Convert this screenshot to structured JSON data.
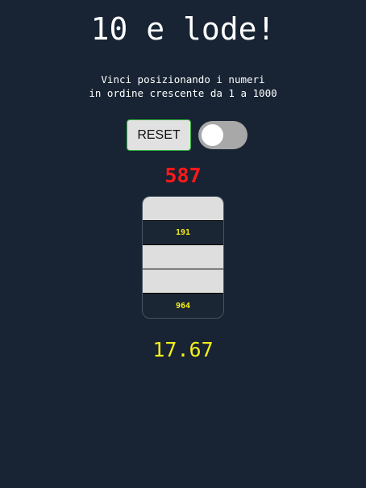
{
  "title": "10 e lode!",
  "subtitle": {
    "line1": "Vinci posizionando i numeri",
    "line2": "in ordine crescente da 1 a 1000"
  },
  "controls": {
    "reset_label": "RESET",
    "toggle_on": false
  },
  "current_number": "587",
  "slots": [
    {
      "value": ""
    },
    {
      "value": "191"
    },
    {
      "value": ""
    },
    {
      "value": ""
    },
    {
      "value": "964"
    }
  ],
  "score": "17.67",
  "colors": {
    "background": "#182433",
    "current_number": "#ff1a1a",
    "slot_text": "#f5ef1a",
    "score": "#f5ef1a",
    "empty_slot": "#dedede"
  }
}
